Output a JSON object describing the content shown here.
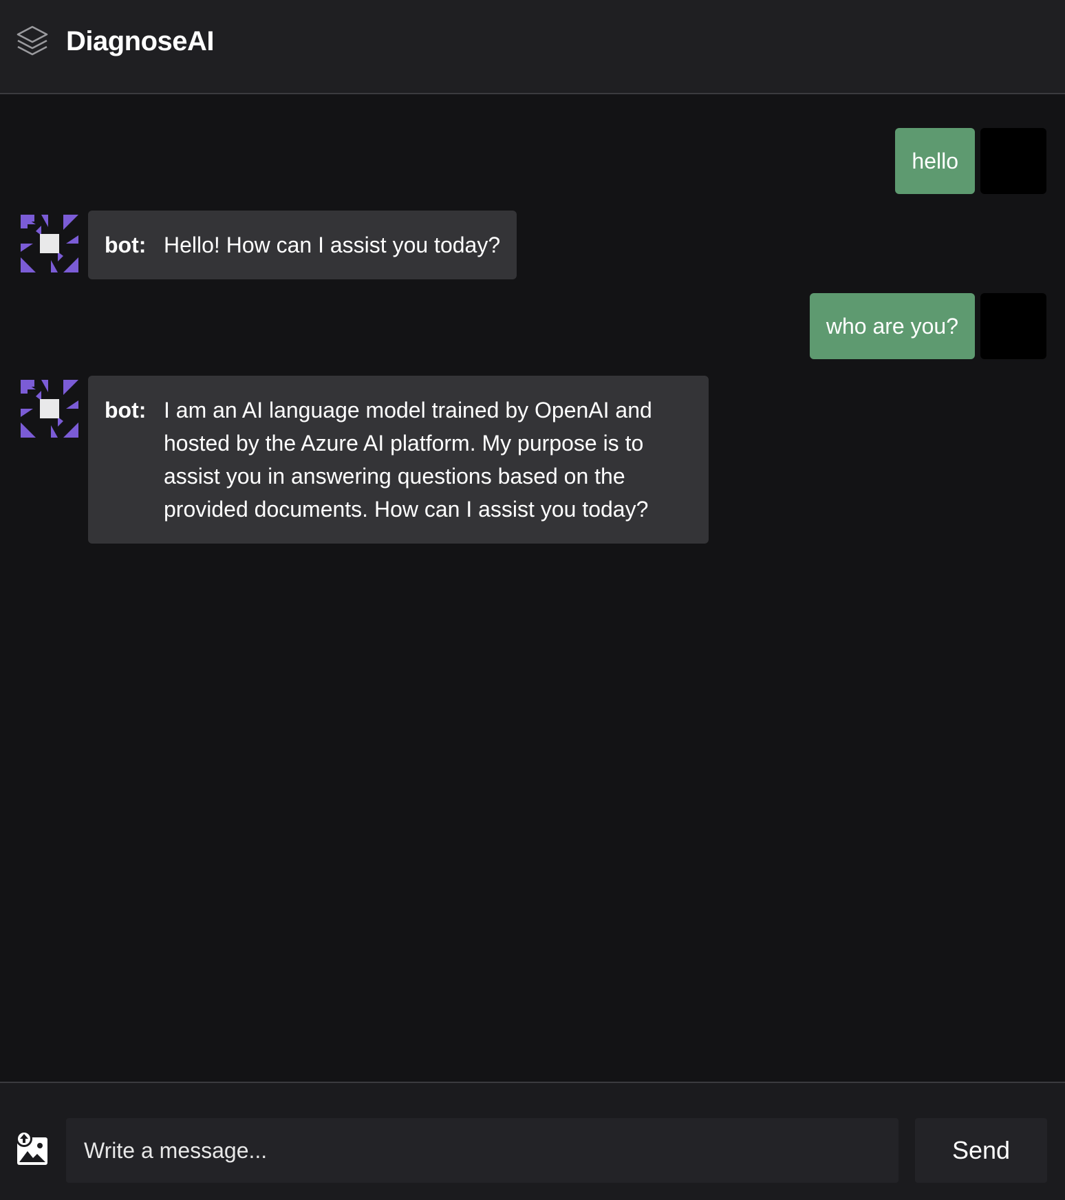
{
  "header": {
    "title": "DiagnoseAI",
    "logo_icon": "layers-icon"
  },
  "messages": [
    {
      "role": "user",
      "text": "hello"
    },
    {
      "role": "bot",
      "sender": "bot:",
      "text": "Hello! How can I assist you today?"
    },
    {
      "role": "user",
      "text": "who are you?"
    },
    {
      "role": "bot",
      "sender": "bot:",
      "text": "I am an AI language model trained by OpenAI and hosted by the Azure AI platform. My purpose is to assist you in answering questions based on the provided documents. How can I assist you today?"
    }
  ],
  "composer": {
    "upload_icon": "image-upload-icon",
    "placeholder": "Write a message...",
    "value": "",
    "send_label": "Send"
  },
  "colors": {
    "user_bubble": "#5e9a70",
    "bot_bubble": "#343437",
    "bot_avatar_accent": "#7b5cd6",
    "background": "#131315",
    "header": "#1f1f22"
  }
}
